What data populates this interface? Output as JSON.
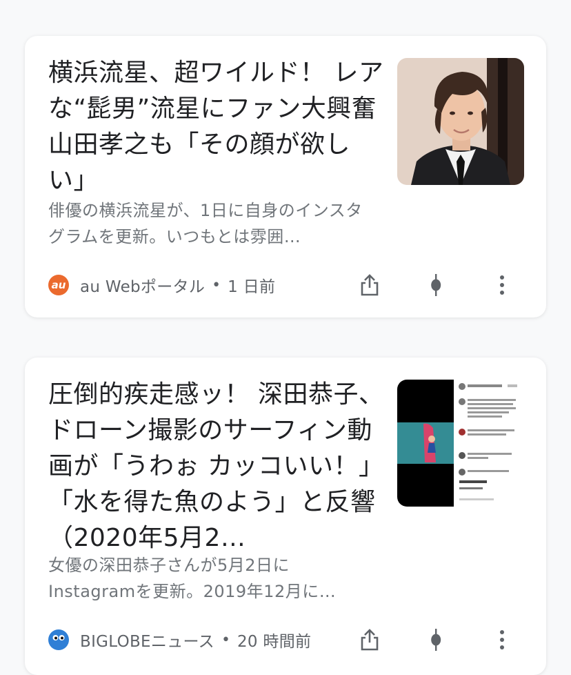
{
  "articles": [
    {
      "title": "横浜流星、超ワイルド！ レアな“髭男”流星にファン大興奮 山田孝之も「その顔が欲しい」",
      "snippet": "俳優の横浜流星が、1日に自身のインスタグラムを更新。いつもとは雰囲…",
      "source": "au Webポータル",
      "separator": "•",
      "time": "1 日前",
      "source_logo_text": "au",
      "source_logo_color": "#eb6a2e"
    },
    {
      "title": "圧倒的疾走感ッ！ 深田恭子、ドローン撮影のサーフィン動画が「うわぉ カッコいい！」「水を得た魚のよう」と反響（2020年5月2…",
      "snippet": "女優の深田恭子さんが5月2日にInstagramを更新。2019年12月に…",
      "source": "BIGLOBEニュース",
      "separator": "•",
      "time": "20 時間前",
      "source_logo_color": "#2f7fd6"
    }
  ],
  "icons": {
    "share": "share-icon",
    "pin": "pin-icon",
    "more": "more-vert-icon"
  }
}
